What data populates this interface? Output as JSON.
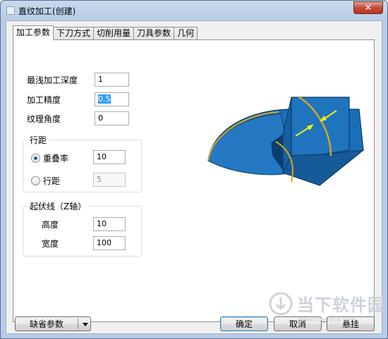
{
  "window": {
    "title": "直纹加工(创建)",
    "close_glyph": "✕"
  },
  "tabs": [
    {
      "label": "加工参数",
      "active": true
    },
    {
      "label": "下刀方式",
      "active": false
    },
    {
      "label": "切削用量",
      "active": false
    },
    {
      "label": "刀具参数",
      "active": false
    },
    {
      "label": "几何",
      "active": false
    }
  ],
  "params": {
    "min_depth_label": "最浅加工深度",
    "min_depth_value": "1",
    "precision_label": "加工精度",
    "precision_value": "0.5",
    "texture_angle_label": "纹理角度",
    "texture_angle_value": "0"
  },
  "row_spacing_group": {
    "title": "行距",
    "overlap_label": "重叠率",
    "overlap_value": "10",
    "overlap_checked": true,
    "spacing_label": "行距",
    "spacing_value": "5",
    "spacing_checked": false
  },
  "undulation_group": {
    "title": "起伏线（Z轴）",
    "height_label": "高度",
    "height_value": "10",
    "width_label": "宽度",
    "width_value": "100"
  },
  "buttons": {
    "defaults": "缺省参数",
    "ok": "确定",
    "cancel": "取消",
    "suspend": "悬挂"
  },
  "watermark": {
    "text": "当下软件园",
    "sub": "www.downxia.com"
  },
  "colors": {
    "shape_fill": "#1a6fb8",
    "shape_edge": "#0c3c66",
    "curve": "#d9a520",
    "arrow": "#e6f020"
  }
}
